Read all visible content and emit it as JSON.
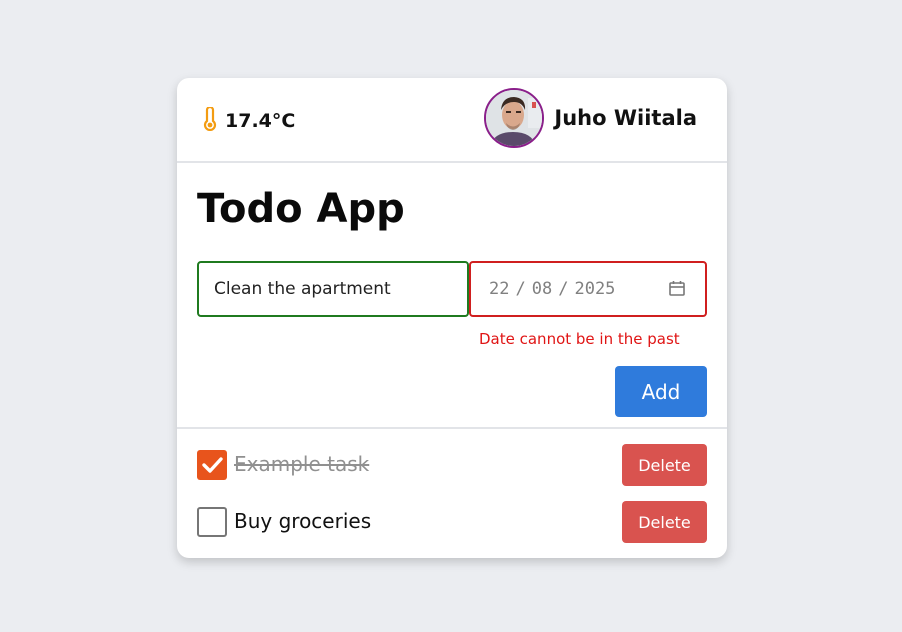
{
  "header": {
    "temperature": "17.4°C",
    "thermometer_icon": "thermometer-icon",
    "username": "Juho Wiitala"
  },
  "title": "Todo App",
  "form": {
    "todo_value": "Clean the apartment",
    "date_day": "22",
    "date_month": "08",
    "date_year": "2025",
    "date_separator": "/",
    "error": "Date cannot be in the past",
    "add_label": "Add"
  },
  "todos": [
    {
      "text": "Example task",
      "done": true,
      "delete_label": "Delete"
    },
    {
      "text": "Buy groceries",
      "done": false,
      "delete_label": "Delete"
    }
  ],
  "colors": {
    "accent": "#2f7bdc",
    "danger": "#d9534f",
    "error": "#e01515",
    "checked": "#e8541c",
    "valid_border": "#1f7a1f"
  }
}
